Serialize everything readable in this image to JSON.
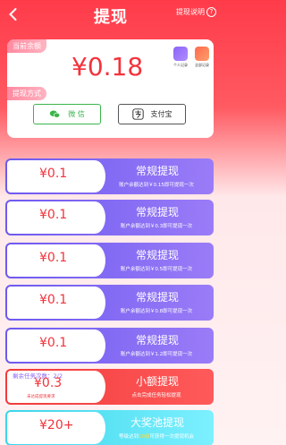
{
  "header": {
    "title": "提现",
    "help_label": "提现说明",
    "help_glyph": "?"
  },
  "balance": {
    "label": "当前余额",
    "amount": "¥0.18",
    "badges": [
      {
        "label": "个人记录",
        "icon": "person-record-icon"
      },
      {
        "label": "全部记录",
        "icon": "all-records-icon"
      }
    ]
  },
  "withdraw_method": {
    "label": "提现方式",
    "options": [
      {
        "name": "微 信",
        "icon": "wechat-icon",
        "selected": true
      },
      {
        "name": "支付宝",
        "icon": "alipay-icon",
        "selected": false
      }
    ]
  },
  "rows": [
    {
      "value": "¥0.1",
      "title": "常规提现",
      "desc": "账户余额达到￥0.15即可提现一次"
    },
    {
      "value": "¥0.1",
      "title": "常规提现",
      "desc": "账户余额达到￥0.3即可提现一次"
    },
    {
      "value": "¥0.1",
      "title": "常规提现",
      "desc": "账户余额达到￥0.5即可提现一次"
    },
    {
      "value": "¥0.1",
      "title": "常规提现",
      "desc": "账户余额达到￥0.8即可提现一次"
    },
    {
      "value": "¥0.1",
      "title": "常规提现",
      "desc": "账户余额达到￥1.2即可提现一次"
    }
  ],
  "small_row": {
    "stage": "剩余任务次数：2/2",
    "value": "¥0.3",
    "note": "未达成提现要求",
    "title": "小额提现",
    "desc": "点击完成任务轻松提现"
  },
  "jackpot_row": {
    "value": "¥20+",
    "title": "大奖池提现",
    "desc_prefix": "等级达到",
    "desc_highlight": "10级",
    "desc_suffix": "可获得一次提现机会"
  },
  "colors": {
    "accent": "#f2333c",
    "purple": "#6d59f0",
    "wechat": "#3bb54a",
    "cyan": "#3ad6ea"
  }
}
